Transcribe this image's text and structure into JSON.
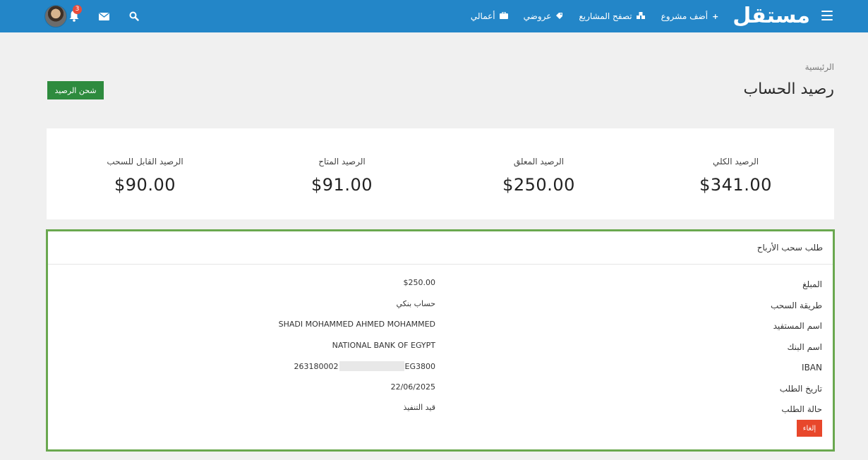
{
  "navbar": {
    "logo": "مستقل",
    "links": [
      {
        "label": "أضف مشروع",
        "icon": "plus-icon"
      },
      {
        "label": "تصفح المشاريع",
        "icon": "cubes-icon"
      },
      {
        "label": "عروضي",
        "icon": "tag-icon"
      },
      {
        "label": "أعمالي",
        "icon": "briefcase-icon"
      }
    ],
    "notifications_count": "3"
  },
  "page": {
    "breadcrumb": "الرئيسية",
    "title": "رصيد الحساب",
    "charge_button": "شحن الرصيد"
  },
  "balances": [
    {
      "label": "الرصيد الكلي",
      "value": "$341.00"
    },
    {
      "label": "الرصيد المعلق",
      "value": "$250.00"
    },
    {
      "label": "الرصيد المتاح",
      "value": "$91.00"
    },
    {
      "label": "الرصيد القابل للسحب",
      "value": "$90.00"
    }
  ],
  "withdrawal": {
    "title": "طلب سحب الأرباح",
    "rows": [
      {
        "label": "المبلغ",
        "value": "$250.00"
      },
      {
        "label": "طريقة السحب",
        "value": "حساب بنكي"
      },
      {
        "label": "اسم المستفيد",
        "value": "SHADI MOHAMMED AHMED MOHAMMED"
      },
      {
        "label": "اسم البنك",
        "value": "NATIONAL BANK OF EGYPT"
      },
      {
        "label": "IBAN",
        "value_prefix": "EG3800",
        "value_suffix": "263180002"
      },
      {
        "label": "تاريخ الطلب",
        "value": "22/06/2025"
      },
      {
        "label": "حالة الطلب",
        "value": "قيد التنفيذ"
      }
    ],
    "cancel_button": "إلغاء"
  },
  "colors": {
    "navbar": "#2386c8",
    "charge_button": "#2e8b3e",
    "panel_border": "#6aa84f",
    "cancel_button": "#e8472b",
    "badge": "#e74c3c"
  }
}
